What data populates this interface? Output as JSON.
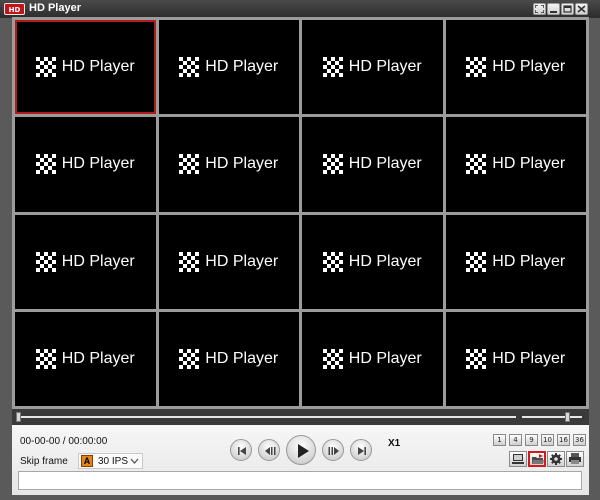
{
  "window": {
    "title": "HD Player",
    "app_icon_text": "HD"
  },
  "grid": {
    "columns": 4,
    "rows": 4,
    "tile_label": "HD Player",
    "selected_index": 0,
    "selected_color": "#b01c1c"
  },
  "controls": {
    "time_display": "00-00-00 / 00:00:00",
    "skip_frame_label": "Skip frame",
    "fps_icon_text": "A",
    "fps_value": "30 IPS",
    "speed_label": "X1",
    "layout_buttons": [
      "1",
      "4",
      "9",
      "10",
      "16",
      "36"
    ],
    "playback_buttons": [
      "skip-to-start",
      "step-back",
      "play",
      "step-forward",
      "skip-to-end"
    ],
    "tools": [
      "monitor",
      "snapshot-folder",
      "settings",
      "print"
    ],
    "active_tool": "snapshot-folder"
  },
  "colors": {
    "tile_background": "#000000",
    "title_bar": "#2c2c2c",
    "accent_red": "#d11a1a"
  }
}
